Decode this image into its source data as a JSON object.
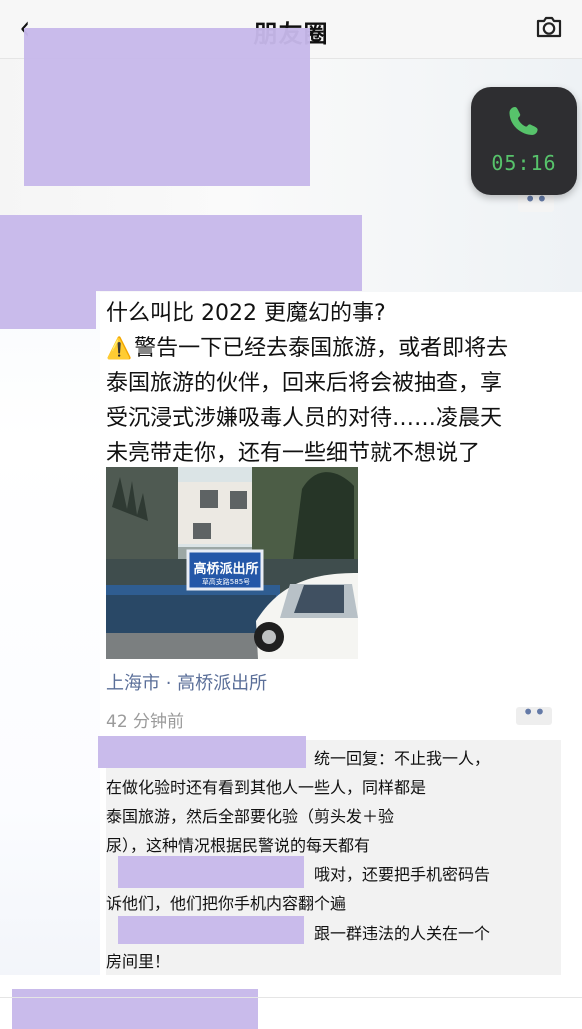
{
  "header": {
    "back_icon": "back-chevron-icon",
    "title": "朋友圈",
    "camera_icon": "camera-icon"
  },
  "call": {
    "icon": "phone-icon",
    "time": "05:16",
    "accent": "#57c36b"
  },
  "post": {
    "title": "什么叫比 2022 更魔幻的事?",
    "warning_icon": "⚠️",
    "lines": [
      "警告一下已经去泰国旅游，或者即将去",
      "泰国旅游的伙伴，回来后将会被抽查，享",
      "受沉浸式涉嫌吸毒人员的对待……凌晨天",
      "未亮带走你，还有一些细节就不想说了"
    ],
    "photo": {
      "sign_text": "高桥派出所",
      "sign_subtext": "草高支路585号"
    },
    "location": "上海市 · 高桥派出所",
    "time_ago": "42 分钟前",
    "more_icon": "more-dots-icon"
  },
  "comments": [
    {
      "lines": [
        "统一回复：不止我一人，",
        "在做化验时还有看到其他人一些人，同样都是",
        "泰国旅游，然后全部要化验（剪头发＋验",
        "尿），这种情况根据民警说的每天都有"
      ]
    },
    {
      "lines": [
        "哦对，还要把手机密码告",
        "诉他们，他们把你手机内容翻个遍"
      ]
    },
    {
      "lines": [
        "跟一群违法的人关在一个",
        "房间里！"
      ]
    }
  ],
  "colors": {
    "redaction": "#c7b8ea",
    "link": "#5b6f99",
    "comment_bg": "#f2f2f2"
  }
}
